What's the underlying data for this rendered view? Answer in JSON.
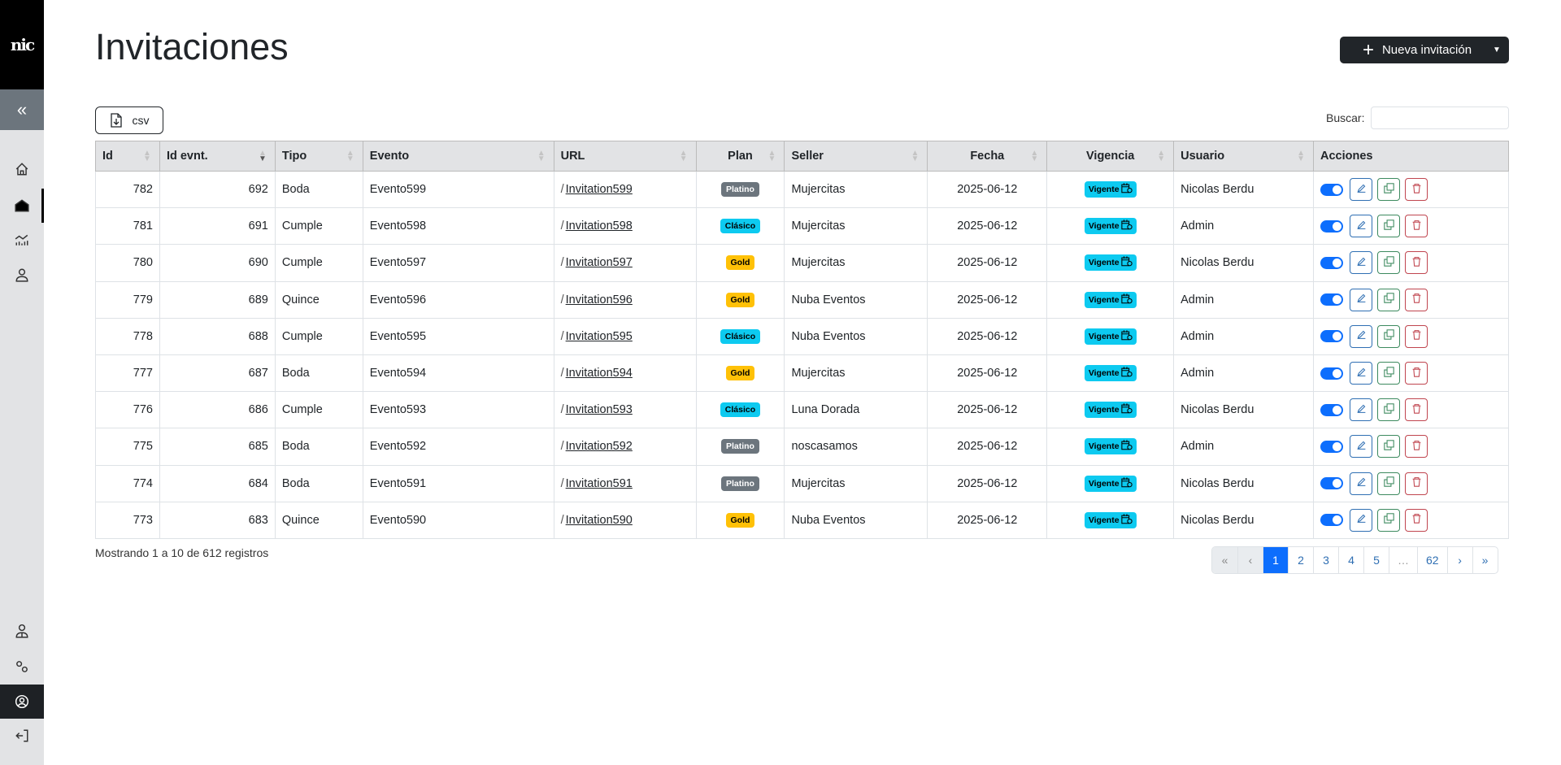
{
  "sidebar": {
    "logo": "nic",
    "collapse_icon": "«"
  },
  "header": {
    "title": "Invitaciones",
    "new_button": "Nueva invitación"
  },
  "toolbar": {
    "csv_label": "csv",
    "search_label": "Buscar:",
    "search_value": ""
  },
  "table": {
    "columns": [
      "Id",
      "Id evnt.",
      "Tipo",
      "Evento",
      "URL",
      "Plan",
      "Seller",
      "Fecha",
      "Vigencia",
      "Usuario",
      "Acciones"
    ],
    "rows": [
      {
        "id": "782",
        "evnt": "692",
        "tipo": "Boda",
        "evento": "Evento599",
        "url": "Invitation599",
        "plan": "Platino",
        "seller": "Mujercitas",
        "fecha": "2025-06-12",
        "vigencia": "Vigente",
        "usuario": "Nicolas Berdu"
      },
      {
        "id": "781",
        "evnt": "691",
        "tipo": "Cumple",
        "evento": "Evento598",
        "url": "Invitation598",
        "plan": "Clásico",
        "seller": "Mujercitas",
        "fecha": "2025-06-12",
        "vigencia": "Vigente",
        "usuario": "Admin"
      },
      {
        "id": "780",
        "evnt": "690",
        "tipo": "Cumple",
        "evento": "Evento597",
        "url": "Invitation597",
        "plan": "Gold",
        "seller": "Mujercitas",
        "fecha": "2025-06-12",
        "vigencia": "Vigente",
        "usuario": "Nicolas Berdu"
      },
      {
        "id": "779",
        "evnt": "689",
        "tipo": "Quince",
        "evento": "Evento596",
        "url": "Invitation596",
        "plan": "Gold",
        "seller": "Nuba Eventos",
        "fecha": "2025-06-12",
        "vigencia": "Vigente",
        "usuario": "Admin"
      },
      {
        "id": "778",
        "evnt": "688",
        "tipo": "Cumple",
        "evento": "Evento595",
        "url": "Invitation595",
        "plan": "Clásico",
        "seller": "Nuba Eventos",
        "fecha": "2025-06-12",
        "vigencia": "Vigente",
        "usuario": "Admin"
      },
      {
        "id": "777",
        "evnt": "687",
        "tipo": "Boda",
        "evento": "Evento594",
        "url": "Invitation594",
        "plan": "Gold",
        "seller": "Mujercitas",
        "fecha": "2025-06-12",
        "vigencia": "Vigente",
        "usuario": "Admin"
      },
      {
        "id": "776",
        "evnt": "686",
        "tipo": "Cumple",
        "evento": "Evento593",
        "url": "Invitation593",
        "plan": "Clásico",
        "seller": "Luna Dorada",
        "fecha": "2025-06-12",
        "vigencia": "Vigente",
        "usuario": "Nicolas Berdu"
      },
      {
        "id": "775",
        "evnt": "685",
        "tipo": "Boda",
        "evento": "Evento592",
        "url": "Invitation592",
        "plan": "Platino",
        "seller": "noscasamos",
        "fecha": "2025-06-12",
        "vigencia": "Vigente",
        "usuario": "Admin"
      },
      {
        "id": "774",
        "evnt": "684",
        "tipo": "Boda",
        "evento": "Evento591",
        "url": "Invitation591",
        "plan": "Platino",
        "seller": "Mujercitas",
        "fecha": "2025-06-12",
        "vigencia": "Vigente",
        "usuario": "Nicolas Berdu"
      },
      {
        "id": "773",
        "evnt": "683",
        "tipo": "Quince",
        "evento": "Evento590",
        "url": "Invitation590",
        "plan": "Gold",
        "seller": "Nuba Eventos",
        "fecha": "2025-06-12",
        "vigencia": "Vigente",
        "usuario": "Nicolas Berdu"
      }
    ]
  },
  "footer": {
    "info": "Mostrando 1 a 10 de 612 registros"
  },
  "pagination": {
    "first": "«",
    "prev": "‹",
    "pages": [
      "1",
      "2",
      "3",
      "4",
      "5",
      "…",
      "62"
    ],
    "next": "›",
    "last": "»",
    "current": "1"
  },
  "colors": {
    "accent": "#0d6efd",
    "dark": "#212529",
    "info": "#0dcaf0",
    "gold": "#ffc107",
    "platino": "#6c757d"
  }
}
